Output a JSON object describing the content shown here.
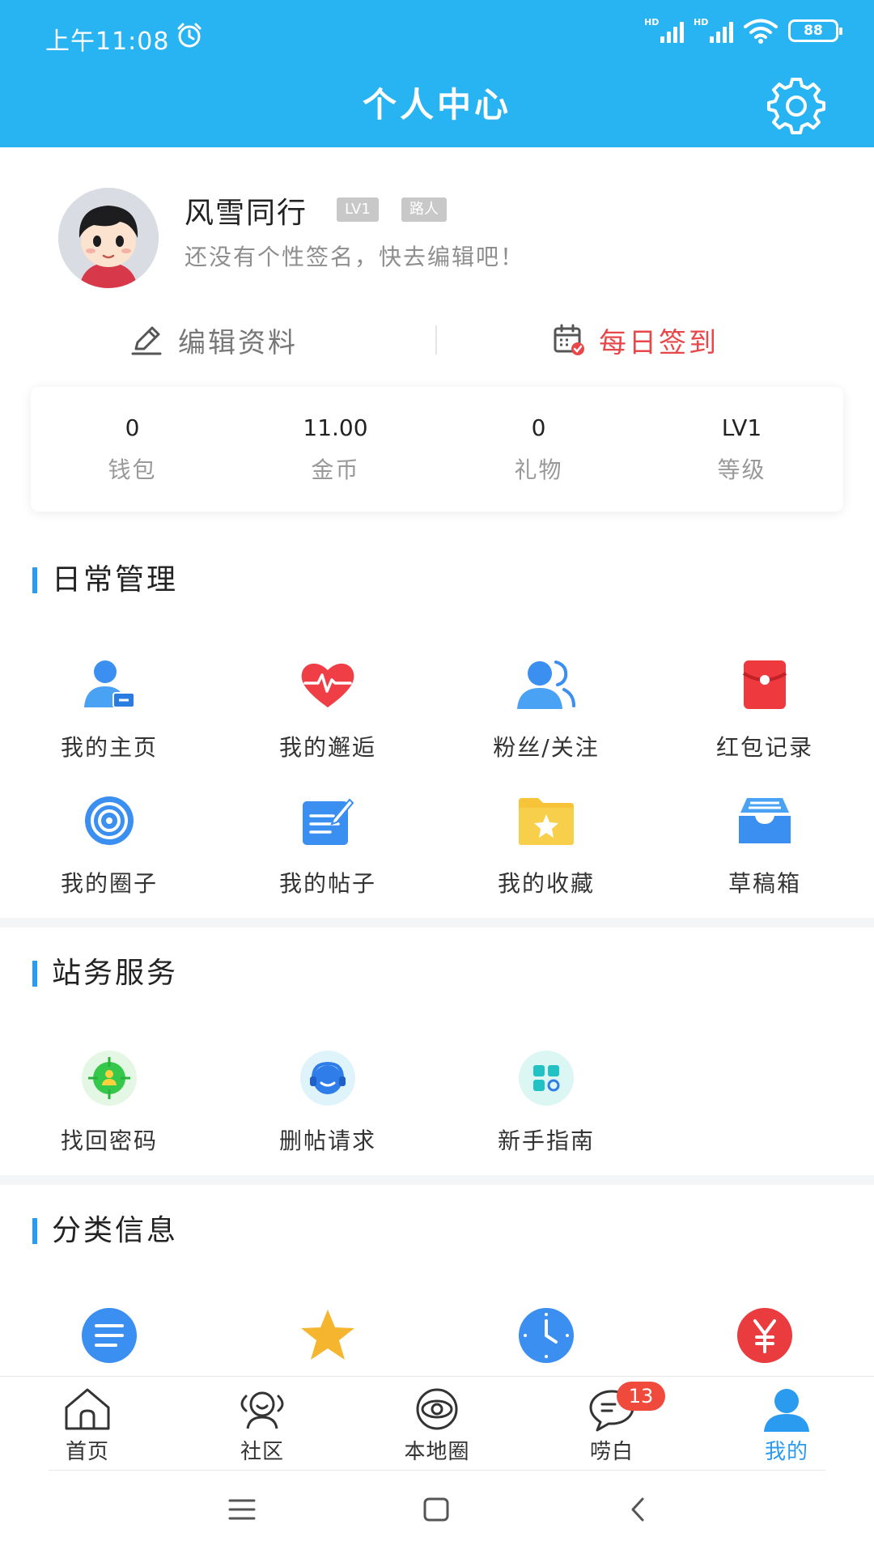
{
  "status_bar": {
    "time": "上午11:08",
    "signal1_label": "HD",
    "signal2_label": "HD",
    "battery": "88"
  },
  "header": {
    "title": "个人中心"
  },
  "profile": {
    "username": "风雪同行",
    "level_badge": "LV1",
    "role_badge": "路人",
    "signature": "还没有个性签名，快去编辑吧！",
    "edit_label": "编辑资料",
    "checkin_label": "每日签到"
  },
  "stats": [
    {
      "value": "0",
      "label": "钱包"
    },
    {
      "value": "11.00",
      "label": "金币"
    },
    {
      "value": "0",
      "label": "礼物"
    },
    {
      "value": "LV1",
      "label": "等级"
    }
  ],
  "sections": {
    "daily": {
      "title": "日常管理",
      "items": [
        {
          "label": "我的主页",
          "icon": "user-home-icon"
        },
        {
          "label": "我的邂逅",
          "icon": "heart-pulse-icon"
        },
        {
          "label": "粉丝/关注",
          "icon": "followers-icon"
        },
        {
          "label": "红包记录",
          "icon": "red-envelope-icon"
        },
        {
          "label": "我的圈子",
          "icon": "circle-target-icon"
        },
        {
          "label": "我的帖子",
          "icon": "post-edit-icon"
        },
        {
          "label": "我的收藏",
          "icon": "star-folder-icon"
        },
        {
          "label": "草稿箱",
          "icon": "inbox-tray-icon"
        }
      ]
    },
    "service": {
      "title": "站务服务",
      "items": [
        {
          "label": "找回密码",
          "icon": "locate-user-icon"
        },
        {
          "label": "删帖请求",
          "icon": "headset-icon"
        },
        {
          "label": "新手指南",
          "icon": "apps-grid-icon"
        }
      ]
    },
    "category": {
      "title": "分类信息",
      "items": [
        {
          "icon": "list-icon"
        },
        {
          "icon": "star-icon"
        },
        {
          "icon": "clock-icon"
        },
        {
          "icon": "yuan-icon"
        }
      ]
    }
  },
  "bottom_nav": [
    {
      "label": "首页",
      "icon": "home-icon"
    },
    {
      "label": "社区",
      "icon": "community-icon"
    },
    {
      "label": "本地圈",
      "icon": "planet-icon"
    },
    {
      "label": "唠白",
      "icon": "chat-bubble-icon",
      "badge": "13"
    },
    {
      "label": "我的",
      "icon": "profile-icon",
      "active": true
    }
  ],
  "colors": {
    "primary": "#28b4f2",
    "accent_blue": "#2a9bef",
    "red": "#e8474a"
  }
}
